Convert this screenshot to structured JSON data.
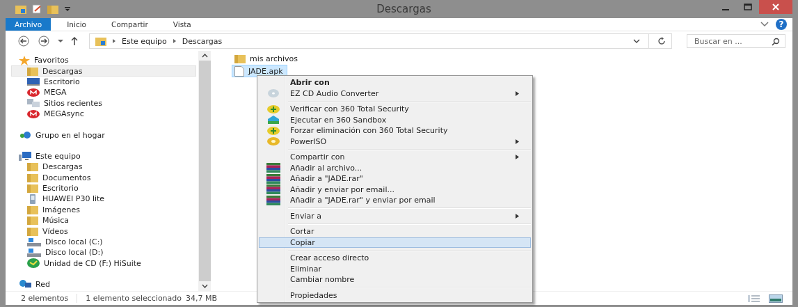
{
  "window": {
    "title": "Descargas"
  },
  "ribbon_tabs": [
    {
      "label": "Archivo",
      "selected": true
    },
    {
      "label": "Inicio",
      "selected": false
    },
    {
      "label": "Compartir",
      "selected": false
    },
    {
      "label": "Vista",
      "selected": false
    }
  ],
  "help_button": "?",
  "address_bar": {
    "path": [
      "Este equipo",
      "Descargas"
    ]
  },
  "search": {
    "placeholder": "Buscar en ..."
  },
  "navigation": [
    {
      "label": "Favoritos",
      "selected": false,
      "children": [
        {
          "label": "Descargas",
          "selected": true
        },
        {
          "label": "Escritorio",
          "selected": false
        },
        {
          "label": "MEGA",
          "selected": false
        },
        {
          "label": "Sitios recientes",
          "selected": false
        },
        {
          "label": "MEGAsync",
          "selected": false
        }
      ]
    },
    {
      "label": "Grupo en el hogar",
      "selected": false
    },
    {
      "label": "Este equipo",
      "selected": false,
      "children": [
        {
          "label": "Descargas",
          "selected": false
        },
        {
          "label": "Documentos",
          "selected": false
        },
        {
          "label": "Escritorio",
          "selected": false
        },
        {
          "label": "HUAWEI P30 lite",
          "selected": false
        },
        {
          "label": "Imágenes",
          "selected": false
        },
        {
          "label": "Música",
          "selected": false
        },
        {
          "label": "Vídeos",
          "selected": false
        },
        {
          "label": "Disco local (C:)",
          "selected": false
        },
        {
          "label": "Disco local (D:)",
          "selected": false
        },
        {
          "label": "Unidad de CD (F:) HiSuite",
          "selected": false
        }
      ]
    },
    {
      "label": "Red",
      "selected": false
    }
  ],
  "files": [
    {
      "name": "mis archivos",
      "kind": "folder",
      "selected": false
    },
    {
      "name": "JADE.apk",
      "kind": "file",
      "selected": true
    }
  ],
  "context_menu": [
    {
      "kind": "header",
      "label": "Abrir con",
      "submenu": false,
      "selected": false
    },
    {
      "kind": "item",
      "label": "EZ CD Audio Converter",
      "submenu": true,
      "selected": false
    },
    {
      "kind": "separator"
    },
    {
      "kind": "item",
      "label": "Verificar con 360 Total Security",
      "submenu": false,
      "selected": false
    },
    {
      "kind": "item",
      "label": "Ejecutar en 360 Sandbox",
      "submenu": false,
      "selected": false
    },
    {
      "kind": "item",
      "label": "Forzar eliminación con 360 Total Security",
      "submenu": false,
      "selected": false
    },
    {
      "kind": "item",
      "label": "PowerISO",
      "submenu": true,
      "selected": false
    },
    {
      "kind": "separator"
    },
    {
      "kind": "item",
      "label": "Compartir con",
      "submenu": true,
      "selected": false
    },
    {
      "kind": "item",
      "label": "Añadir al archivo...",
      "submenu": false,
      "selected": false
    },
    {
      "kind": "item",
      "label": "Añadir a \"JADE.rar\"",
      "submenu": false,
      "selected": false
    },
    {
      "kind": "item",
      "label": "Añadir y enviar por email...",
      "submenu": false,
      "selected": false
    },
    {
      "kind": "item",
      "label": "Añadir a \"JADE.rar\" y enviar por email",
      "submenu": false,
      "selected": false
    },
    {
      "kind": "separator"
    },
    {
      "kind": "item",
      "label": "Enviar a",
      "submenu": true,
      "selected": false
    },
    {
      "kind": "separator"
    },
    {
      "kind": "item",
      "label": "Cortar",
      "submenu": false,
      "selected": false
    },
    {
      "kind": "item",
      "label": "Copiar",
      "submenu": false,
      "selected": true
    },
    {
      "kind": "separator"
    },
    {
      "kind": "item",
      "label": "Crear acceso directo",
      "submenu": false,
      "selected": false
    },
    {
      "kind": "item",
      "label": "Eliminar",
      "submenu": false,
      "selected": false
    },
    {
      "kind": "item",
      "label": "Cambiar nombre",
      "submenu": false,
      "selected": false
    },
    {
      "kind": "separator"
    },
    {
      "kind": "item",
      "label": "Propiedades",
      "submenu": false,
      "selected": false
    }
  ],
  "status_bar": {
    "item_count": "2 elementos",
    "selection": "1 elemento seleccionado",
    "size": "34,7 MB"
  }
}
